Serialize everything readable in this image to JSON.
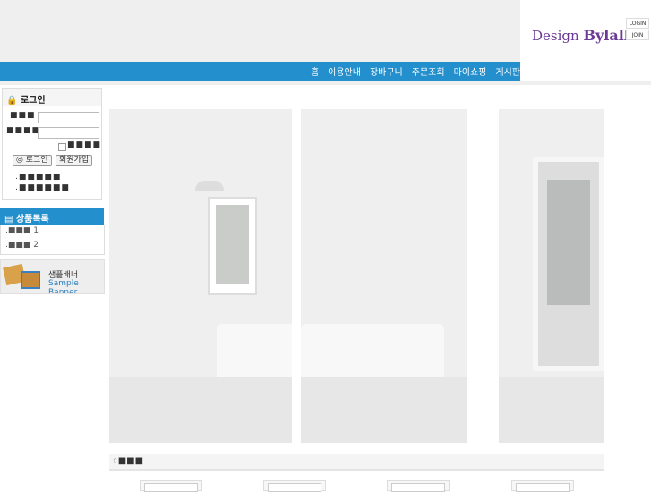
{
  "header": {
    "logo_text_1": "Design",
    "logo_text_2": "Bylalla",
    "login_label": "LOGIN",
    "join_label": "JOIN"
  },
  "nav": {
    "items": [
      "홈",
      "이용안내",
      "장바구니",
      "주문조회",
      "마이쇼핑",
      "게시판"
    ]
  },
  "login": {
    "title": "로그인",
    "id_label": "■■■",
    "pw_label": "■■■■",
    "save_label": "■■■■",
    "login_button": "로그인",
    "join_button": "회원가입",
    "links": [
      "■■■■■",
      "■■■■■■"
    ]
  },
  "category": {
    "title": "상품목록",
    "items": [
      {
        "label": "■■■",
        "num": "1"
      },
      {
        "label": "■■■",
        "num": "2"
      }
    ]
  },
  "banner": {
    "title": "샘플배너",
    "subtitle": "Sample Banner"
  },
  "section": {
    "title": "■■■"
  },
  "colors": {
    "accent": "#238fcd",
    "logo": "#6b3a96"
  }
}
